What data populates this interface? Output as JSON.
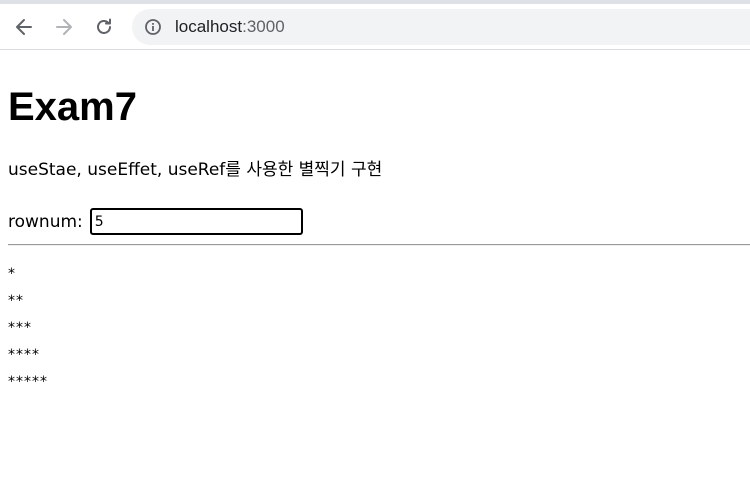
{
  "browser": {
    "url_host": "localhost",
    "url_port": ":3000"
  },
  "page": {
    "title": "Exam7",
    "description": "useStae, useEffet, useRef를 사용한 별찍기 구현",
    "rownum_label": "rownum:",
    "rownum_value": "5",
    "stars": [
      "*",
      "**",
      "***",
      "****",
      "*****"
    ]
  }
}
